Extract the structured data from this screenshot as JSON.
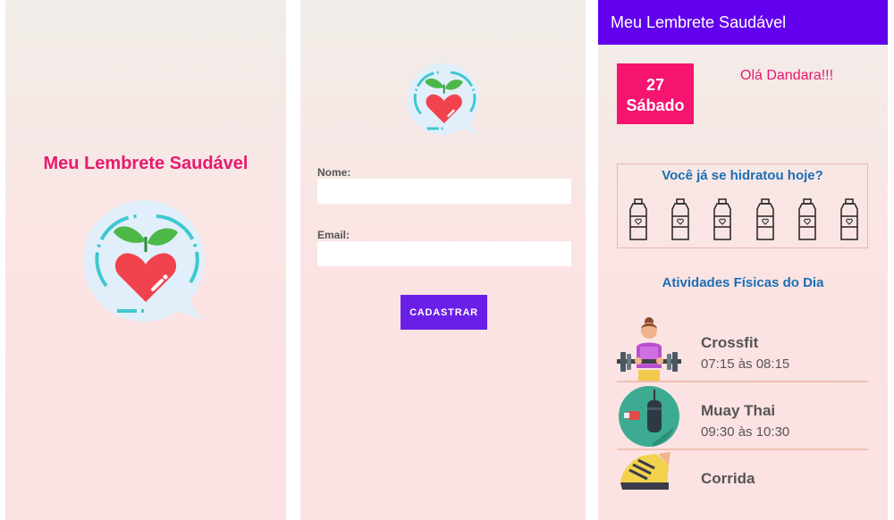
{
  "splash": {
    "title": "Meu Lembrete Saudável"
  },
  "register": {
    "name_label": "Nome:",
    "name_value": "",
    "email_label": "Email:",
    "email_value": "",
    "submit_label": "CADASTRAR"
  },
  "home": {
    "app_title": "Meu Lembrete Saudável",
    "date": {
      "day": "27",
      "weekday": "Sábado"
    },
    "greeting": "Olá Dandara!!!",
    "hydration": {
      "question": "Você já se hidratou hoje?",
      "bottle_icon": "water-bottle-icon"
    },
    "activities_title": "Atividades Físicas do Dia",
    "activities": [
      {
        "name": "Crossfit",
        "time": "07:15 às 08:15",
        "icon": "weightlifter-icon"
      },
      {
        "name": "Muay Thai",
        "time": "09:30 às 10:30",
        "icon": "punching-bag-icon"
      },
      {
        "name": "Corrida",
        "time": "",
        "icon": "running-shoe-icon"
      }
    ]
  },
  "colors": {
    "accent_pink": "#e8196f",
    "date_box": "#f5146f",
    "primary_purple": "#6200ee",
    "button_purple": "#6a1fe6",
    "heading_blue": "#1a6fb5"
  }
}
